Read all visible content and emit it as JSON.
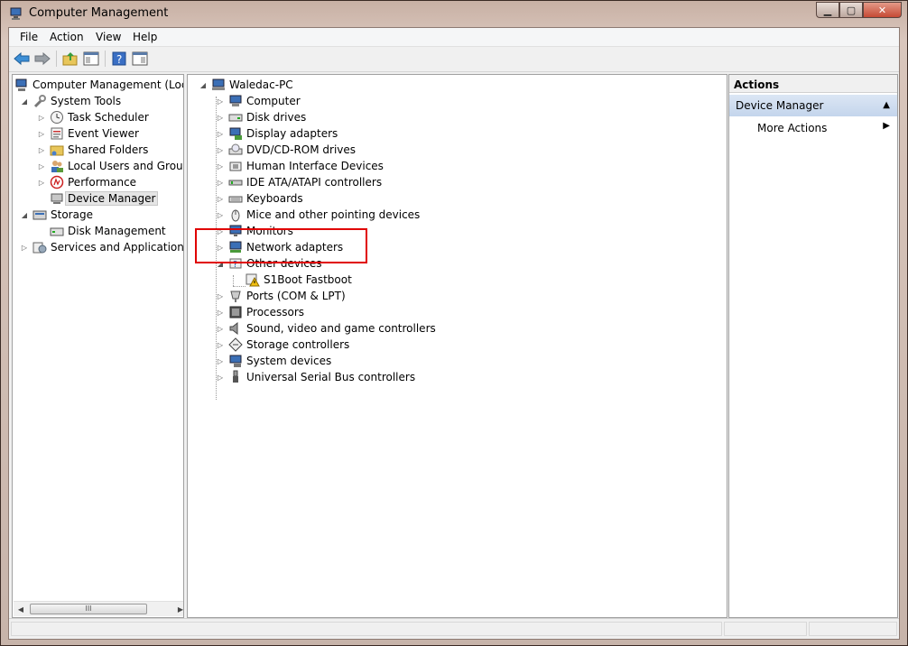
{
  "window": {
    "title": "Computer Management",
    "icon": "computer-management-icon"
  },
  "menubar": {
    "items": [
      "File",
      "Action",
      "View",
      "Help"
    ]
  },
  "toolbar": {
    "buttons": [
      "back-icon",
      "forward-icon",
      "up-folder-icon",
      "show-hide-console-tree-icon",
      "help-icon",
      "show-hide-action-pane-icon"
    ]
  },
  "left_tree": {
    "root": "Computer Management (Local",
    "system_tools": "System Tools",
    "task_scheduler": "Task Scheduler",
    "event_viewer": "Event Viewer",
    "shared_folders": "Shared Folders",
    "local_users": "Local Users and Groups",
    "performance": "Performance",
    "device_manager": "Device Manager",
    "storage": "Storage",
    "disk_management": "Disk Management",
    "services": "Services and Applications"
  },
  "device_tree": {
    "root": "Waledac-PC",
    "items": [
      "Computer",
      "Disk drives",
      "Display adapters",
      "DVD/CD-ROM drives",
      "Human Interface Devices",
      "IDE ATA/ATAPI controllers",
      "Keyboards",
      "Mice and other pointing devices",
      "Monitors",
      "Network adapters",
      "Other devices",
      "S1Boot Fastboot",
      "Ports (COM & LPT)",
      "Processors",
      "Sound, video and game controllers",
      "Storage controllers",
      "System devices",
      "Universal Serial Bus controllers"
    ]
  },
  "actions": {
    "header": "Actions",
    "section": "Device Manager",
    "more": "More Actions"
  },
  "scrollbar": {
    "grip": "III"
  }
}
